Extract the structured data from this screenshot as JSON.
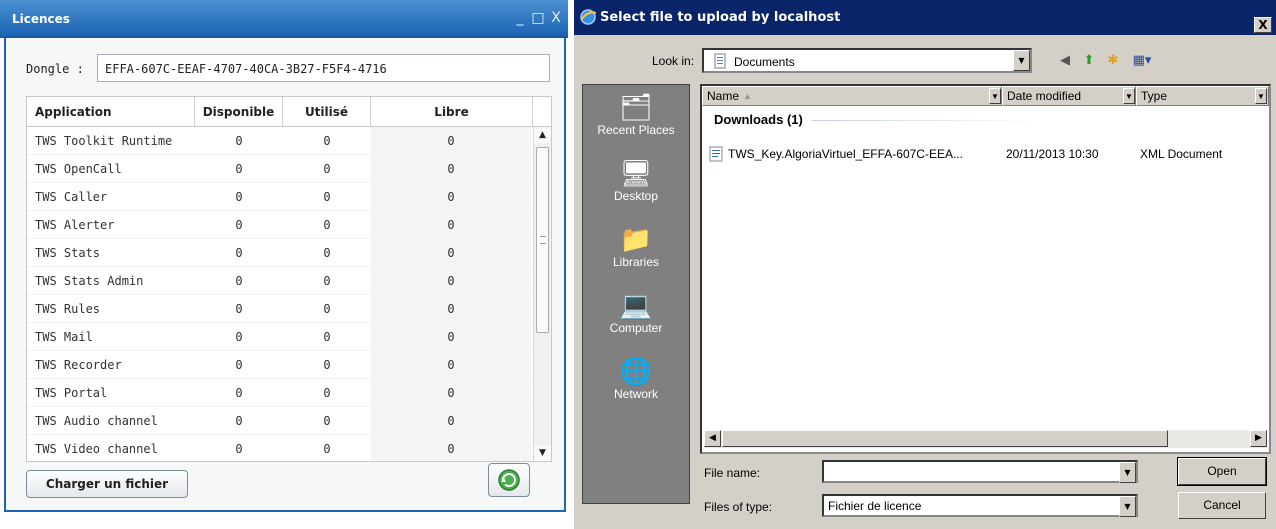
{
  "licences": {
    "title": "Licences",
    "window_buttons": {
      "minimize": "_",
      "maximize": "□",
      "close": "X"
    },
    "dongle_label": "Dongle :",
    "dongle_value": "EFFA-607C-EEAF-4707-40CA-3B27-F5F4-4716",
    "columns": [
      "Application",
      "Disponible",
      "Utilisé",
      "Libre"
    ],
    "rows": [
      {
        "app": "TWS Toolkit Runtime",
        "disponible": "0",
        "utilise": "0",
        "libre": "0"
      },
      {
        "app": "TWS OpenCall",
        "disponible": "0",
        "utilise": "0",
        "libre": "0"
      },
      {
        "app": "TWS Caller",
        "disponible": "0",
        "utilise": "0",
        "libre": "0"
      },
      {
        "app": "TWS Alerter",
        "disponible": "0",
        "utilise": "0",
        "libre": "0"
      },
      {
        "app": "TWS Stats",
        "disponible": "0",
        "utilise": "0",
        "libre": "0"
      },
      {
        "app": "TWS Stats Admin",
        "disponible": "0",
        "utilise": "0",
        "libre": "0"
      },
      {
        "app": "TWS Rules",
        "disponible": "0",
        "utilise": "0",
        "libre": "0"
      },
      {
        "app": "TWS Mail",
        "disponible": "0",
        "utilise": "0",
        "libre": "0"
      },
      {
        "app": "TWS Recorder",
        "disponible": "0",
        "utilise": "0",
        "libre": "0"
      },
      {
        "app": "TWS Portal",
        "disponible": "0",
        "utilise": "0",
        "libre": "0"
      },
      {
        "app": "TWS Audio channel",
        "disponible": "0",
        "utilise": "0",
        "libre": "0"
      },
      {
        "app": "TWS Video channel",
        "disponible": "0",
        "utilise": "0",
        "libre": "0"
      }
    ],
    "upload_button": "Charger un fichier",
    "refresh_icon": "refresh-icon"
  },
  "dialog": {
    "title": "Select file to upload by localhost",
    "close": "X",
    "look_in_label": "Look in:",
    "look_in_value": "Documents",
    "places": [
      "Recent Places",
      "Desktop",
      "Libraries",
      "Computer",
      "Network"
    ],
    "columns": [
      "Name",
      "Date modified",
      "Type"
    ],
    "group": "Downloads (1)",
    "file": {
      "name": "TWS_Key.AlgoriaVirtuel_EFFA-607C-EEA...",
      "date": "20/11/2013 10:30",
      "type": "XML Document"
    },
    "file_name_label": "File name:",
    "file_name_value": "",
    "file_type_label": "Files of type:",
    "file_type_value": "Fichier de licence",
    "open_button": "Open",
    "cancel_button": "Cancel"
  }
}
